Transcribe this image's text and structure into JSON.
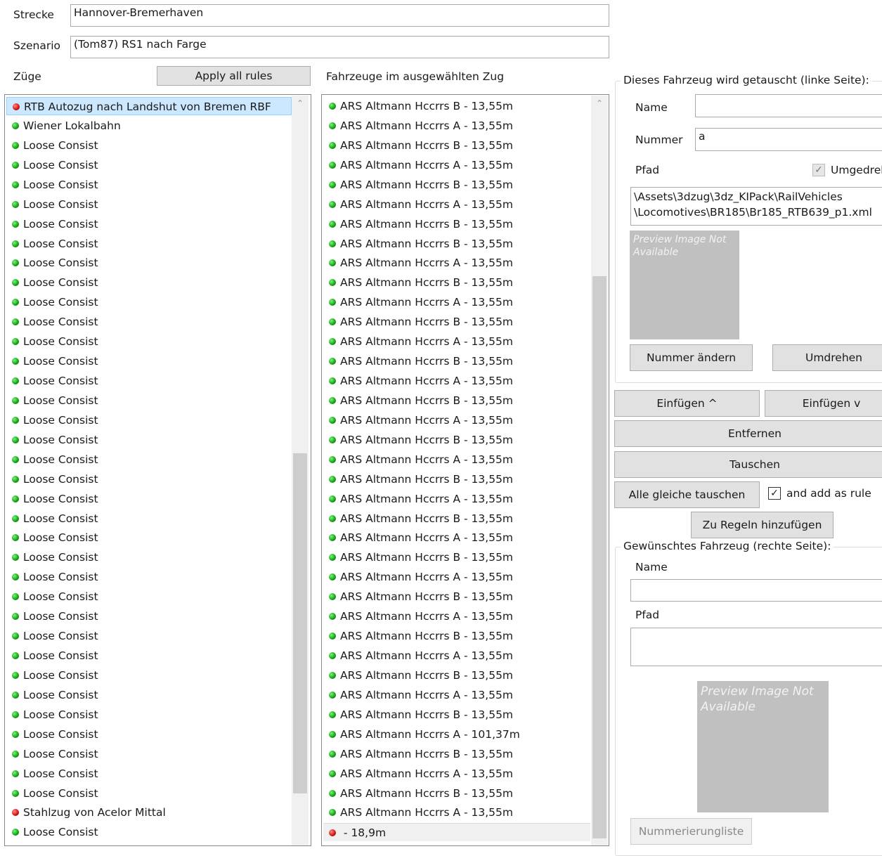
{
  "strecke": {
    "label": "Strecke",
    "value": "Hannover-Bremerhaven"
  },
  "szenario": {
    "label": "Szenario",
    "value": "(Tom87) RS1 nach Farge"
  },
  "zuege": {
    "label": "Züge",
    "apply_button": "Apply all rules",
    "items": [
      {
        "label": "RTB Autozug nach Landshut von Bremen RBF",
        "status": "red",
        "selected": true
      },
      {
        "label": "Wiener Lokalbahn",
        "status": "green"
      },
      {
        "label": "Loose Consist",
        "status": "green"
      },
      {
        "label": "Loose Consist",
        "status": "green"
      },
      {
        "label": "Loose Consist",
        "status": "green"
      },
      {
        "label": "Loose Consist",
        "status": "green"
      },
      {
        "label": "Loose Consist",
        "status": "green"
      },
      {
        "label": "Loose Consist",
        "status": "green"
      },
      {
        "label": "Loose Consist",
        "status": "green"
      },
      {
        "label": "Loose Consist",
        "status": "green"
      },
      {
        "label": "Loose Consist",
        "status": "green"
      },
      {
        "label": "Loose Consist",
        "status": "green"
      },
      {
        "label": "Loose Consist",
        "status": "green"
      },
      {
        "label": "Loose Consist",
        "status": "green"
      },
      {
        "label": "Loose Consist",
        "status": "green"
      },
      {
        "label": "Loose Consist",
        "status": "green"
      },
      {
        "label": "Loose Consist",
        "status": "green"
      },
      {
        "label": "Loose Consist",
        "status": "green"
      },
      {
        "label": "Loose Consist",
        "status": "green"
      },
      {
        "label": "Loose Consist",
        "status": "green"
      },
      {
        "label": "Loose Consist",
        "status": "green"
      },
      {
        "label": "Loose Consist",
        "status": "green"
      },
      {
        "label": "Loose Consist",
        "status": "green"
      },
      {
        "label": "Loose Consist",
        "status": "green"
      },
      {
        "label": "Loose Consist",
        "status": "green"
      },
      {
        "label": "Loose Consist",
        "status": "green"
      },
      {
        "label": "Loose Consist",
        "status": "green"
      },
      {
        "label": "Loose Consist",
        "status": "green"
      },
      {
        "label": "Loose Consist",
        "status": "green"
      },
      {
        "label": "Loose Consist",
        "status": "green"
      },
      {
        "label": "Loose Consist",
        "status": "green"
      },
      {
        "label": "Loose Consist",
        "status": "green"
      },
      {
        "label": "Loose Consist",
        "status": "green"
      },
      {
        "label": "Loose Consist",
        "status": "green"
      },
      {
        "label": "Loose Consist",
        "status": "green"
      },
      {
        "label": "Loose Consist",
        "status": "green"
      },
      {
        "label": "Stahlzug von Acelor Mittal",
        "status": "red"
      },
      {
        "label": "Loose Consist",
        "status": "green"
      }
    ]
  },
  "fahrzeuge": {
    "label": "Fahrzeuge im ausgewählten Zug",
    "items": [
      {
        "label": "ARS Altmann Hccrrs B - 13,55m",
        "status": "green"
      },
      {
        "label": "ARS Altmann Hccrrs A - 13,55m",
        "status": "green"
      },
      {
        "label": "ARS Altmann Hccrrs B - 13,55m",
        "status": "green"
      },
      {
        "label": "ARS Altmann Hccrrs A - 13,55m",
        "status": "green"
      },
      {
        "label": "ARS Altmann Hccrrs B - 13,55m",
        "status": "green"
      },
      {
        "label": "ARS Altmann Hccrrs A - 13,55m",
        "status": "green"
      },
      {
        "label": "ARS Altmann Hccrrs B - 13,55m",
        "status": "green"
      },
      {
        "label": "ARS Altmann Hccrrs B - 13,55m",
        "status": "green"
      },
      {
        "label": "ARS Altmann Hccrrs A - 13,55m",
        "status": "green"
      },
      {
        "label": "ARS Altmann Hccrrs B - 13,55m",
        "status": "green"
      },
      {
        "label": "ARS Altmann Hccrrs A - 13,55m",
        "status": "green"
      },
      {
        "label": "ARS Altmann Hccrrs B - 13,55m",
        "status": "green"
      },
      {
        "label": "ARS Altmann Hccrrs A - 13,55m",
        "status": "green"
      },
      {
        "label": "ARS Altmann Hccrrs B - 13,55m",
        "status": "green"
      },
      {
        "label": "ARS Altmann Hccrrs A - 13,55m",
        "status": "green"
      },
      {
        "label": "ARS Altmann Hccrrs B - 13,55m",
        "status": "green"
      },
      {
        "label": "ARS Altmann Hccrrs A - 13,55m",
        "status": "green"
      },
      {
        "label": "ARS Altmann Hccrrs B - 13,55m",
        "status": "green"
      },
      {
        "label": "ARS Altmann Hccrrs A - 13,55m",
        "status": "green"
      },
      {
        "label": "ARS Altmann Hccrrs B - 13,55m",
        "status": "green"
      },
      {
        "label": "ARS Altmann Hccrrs A - 13,55m",
        "status": "green"
      },
      {
        "label": "ARS Altmann Hccrrs B - 13,55m",
        "status": "green"
      },
      {
        "label": "ARS Altmann Hccrrs A - 13,55m",
        "status": "green"
      },
      {
        "label": "ARS Altmann Hccrrs B - 13,55m",
        "status": "green"
      },
      {
        "label": "ARS Altmann Hccrrs A - 13,55m",
        "status": "green"
      },
      {
        "label": "ARS Altmann Hccrrs B - 13,55m",
        "status": "green"
      },
      {
        "label": "ARS Altmann Hccrrs A - 13,55m",
        "status": "green"
      },
      {
        "label": "ARS Altmann Hccrrs B - 13,55m",
        "status": "green"
      },
      {
        "label": "ARS Altmann Hccrrs A - 13,55m",
        "status": "green"
      },
      {
        "label": "ARS Altmann Hccrrs B - 13,55m",
        "status": "green"
      },
      {
        "label": "ARS Altmann Hccrrs A - 13,55m",
        "status": "green"
      },
      {
        "label": "ARS Altmann Hccrrs B - 13,55m",
        "status": "green"
      },
      {
        "label": "ARS Altmann Hccrrs A - 101,37m",
        "status": "green"
      },
      {
        "label": "ARS Altmann Hccrrs B - 13,55m",
        "status": "green"
      },
      {
        "label": "ARS Altmann Hccrrs A - 13,55m",
        "status": "green"
      },
      {
        "label": "ARS Altmann Hccrrs B - 13,55m",
        "status": "green"
      },
      {
        "label": "ARS Altmann Hccrrs A - 13,55m",
        "status": "green"
      },
      {
        "label": " - 18,9m",
        "status": "red",
        "highlight": true
      }
    ]
  },
  "left_side": {
    "legend": "Dieses Fahrzeug wird getauscht (linke Seite):",
    "name_label": "Name",
    "name_value": "",
    "nummer_label": "Nummer",
    "nummer_value": "a",
    "pfad_label": "Pfad",
    "umgedreht_label": "Umgedreht",
    "umgedreht_checked": true,
    "pfad_line1": "\\Assets\\3dzug\\3dz_KIPack\\RailVehicles",
    "pfad_line2": "\\Locomotives\\BR185\\Br185_RTB639_p1.xml",
    "preview": "Preview Image Not Available",
    "nummer_button": "Nummer ändern",
    "umdrehen_button": "Umdrehen"
  },
  "actions": {
    "einfuegen_up": "Einfügen ^",
    "einfuegen_down": "Einfügen v",
    "entfernen": "Entfernen",
    "tauschen": "Tauschen",
    "alle_tauschen": "Alle gleiche tauschen",
    "add_rule_label": "and add as rule",
    "add_rule_checked": true,
    "zu_regeln": "Zu Regeln hinzufügen"
  },
  "right_side": {
    "legend": "Gewünschtes Fahrzeug (rechte Seite):",
    "name_label": "Name",
    "name_value": "",
    "pfad_label": "Pfad",
    "pfad_value": "",
    "preview": "Preview Image Not Available",
    "nummerierung_button": "Nummerierungliste"
  }
}
